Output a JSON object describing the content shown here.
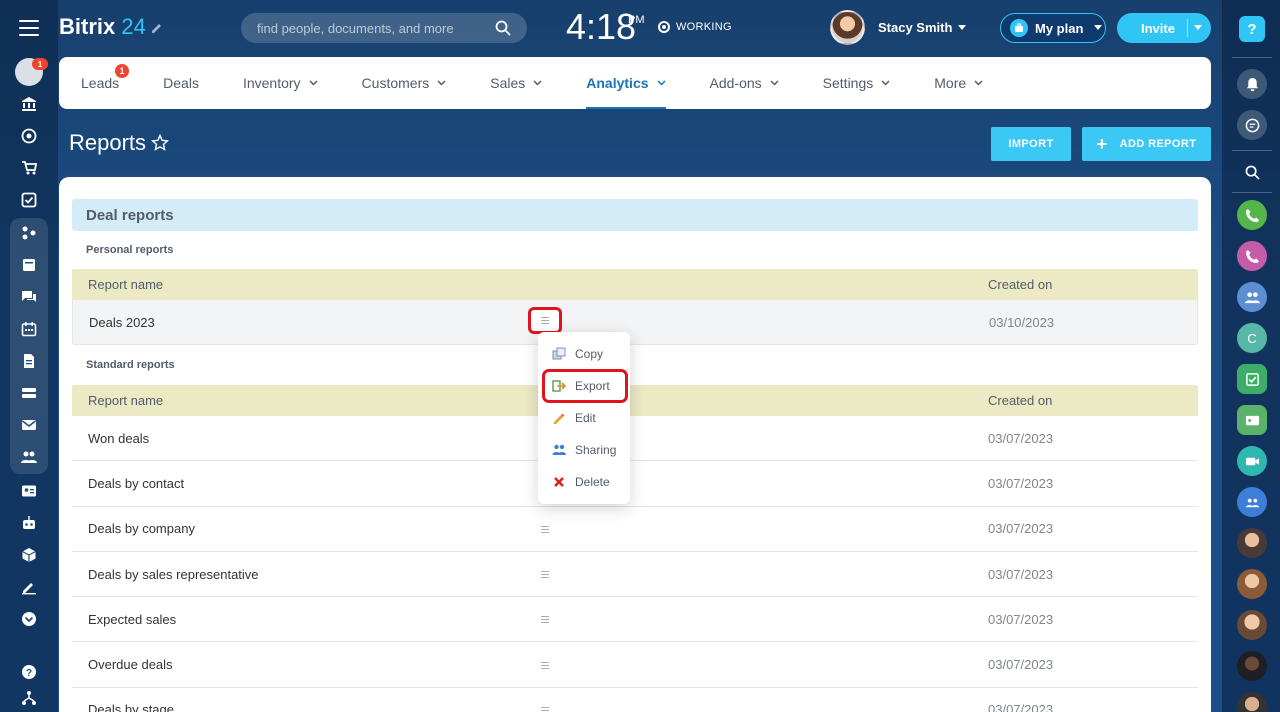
{
  "topbar": {
    "logo_brand": "Bitrix",
    "logo_num": "24",
    "search_placeholder": "find people, documents, and more",
    "clock_time": "4:18",
    "clock_ampm": "PM",
    "status": "WORKING",
    "user_name": "Stacy Smith",
    "myplan_label": "My plan",
    "invite_label": "Invite"
  },
  "left_sidebar": {
    "badge_count": "1"
  },
  "right_sidebar": {
    "help_label": "?",
    "contact_initial": "C"
  },
  "nav": {
    "items": [
      {
        "label": "Leads",
        "badge": "1"
      },
      {
        "label": "Deals"
      },
      {
        "label": "Inventory"
      },
      {
        "label": "Customers"
      },
      {
        "label": "Sales"
      },
      {
        "label": "Analytics"
      },
      {
        "label": "Add-ons"
      },
      {
        "label": "Settings"
      },
      {
        "label": "More"
      }
    ]
  },
  "page": {
    "title": "Reports",
    "import_label": "IMPORT",
    "add_report_label": "ADD REPORT"
  },
  "section": {
    "title": "Deal reports",
    "personal_label": "Personal reports",
    "standard_label": "Standard reports",
    "col_name": "Report name",
    "col_created": "Created on",
    "personal_rows": [
      {
        "name": "Deals 2023",
        "date": "03/10/2023"
      }
    ],
    "standard_rows": [
      {
        "name": "Won deals",
        "date": "03/07/2023"
      },
      {
        "name": "Deals by contact",
        "date": "03/07/2023"
      },
      {
        "name": "Deals by company",
        "date": "03/07/2023"
      },
      {
        "name": "Deals by sales representative",
        "date": "03/07/2023"
      },
      {
        "name": "Expected sales",
        "date": "03/07/2023"
      },
      {
        "name": "Overdue deals",
        "date": "03/07/2023"
      },
      {
        "name": "Deals by stage",
        "date": "03/07/2023"
      }
    ]
  },
  "context_menu": {
    "items": [
      "Copy",
      "Export",
      "Edit",
      "Sharing",
      "Delete"
    ]
  },
  "colors": {
    "accent": "#2fc6f6",
    "active_nav": "#1e74b8",
    "highlight": "#e0141e",
    "section_head": "#d3ecf7",
    "table_head": "#ece9c5"
  }
}
